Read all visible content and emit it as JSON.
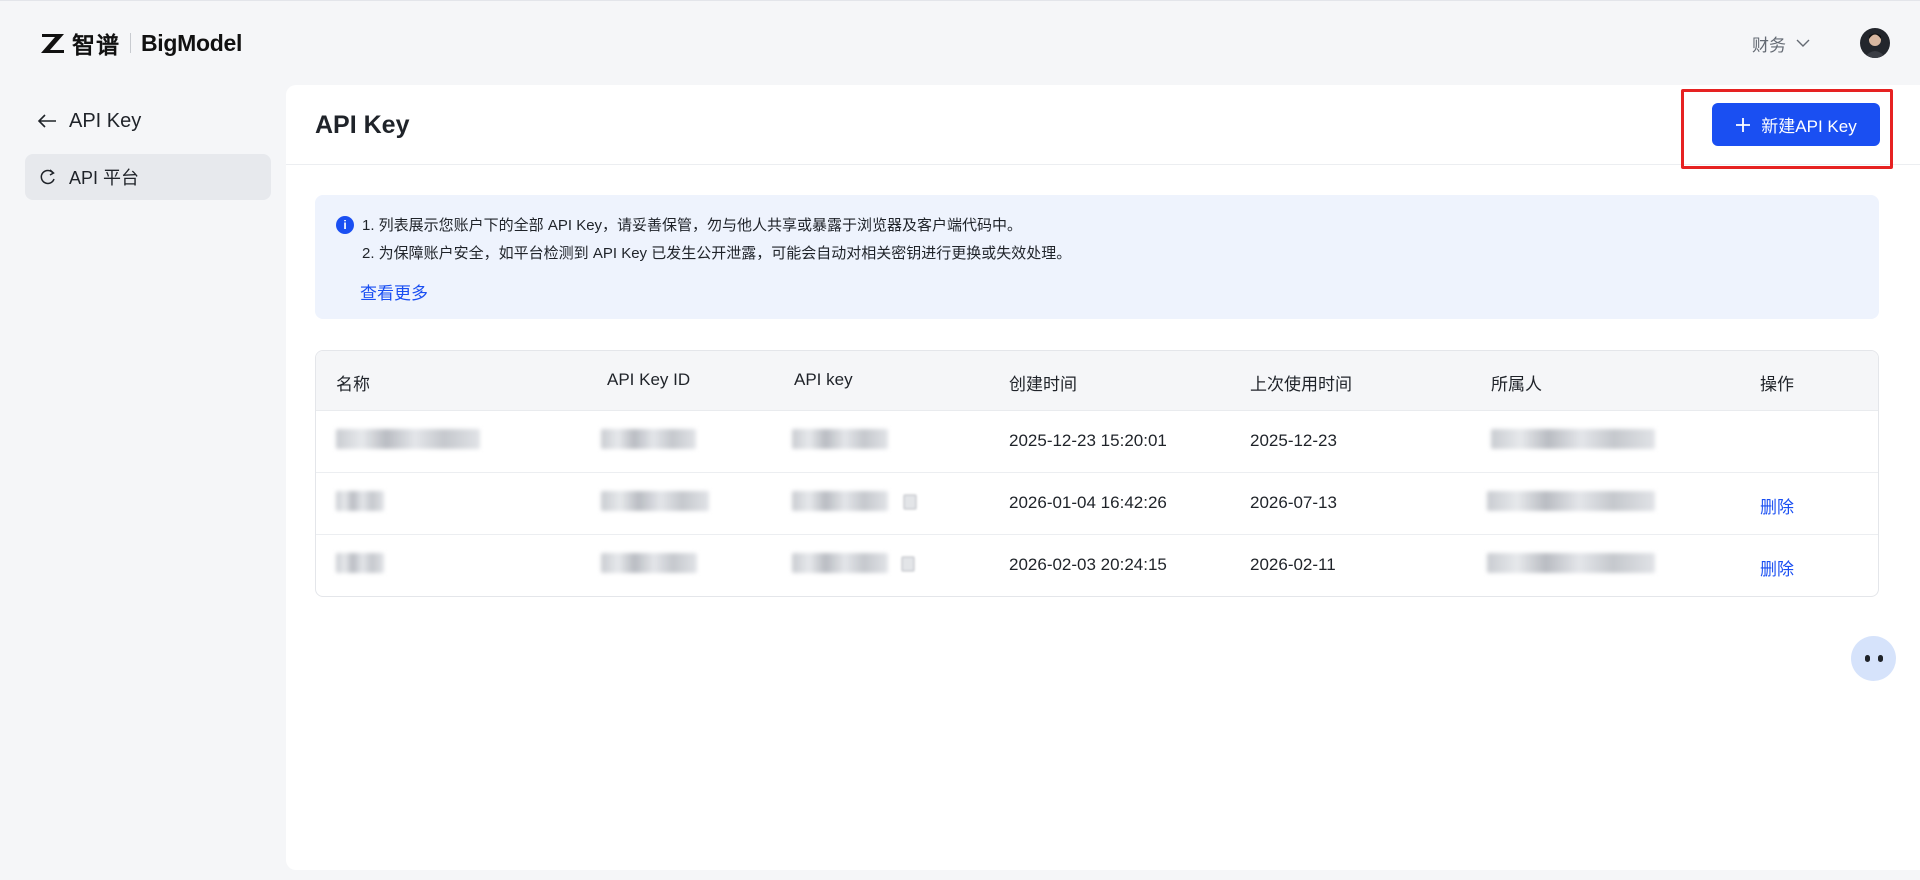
{
  "header": {
    "logo_cn": "智谱",
    "logo_en": "BigModel",
    "finance_label": "财务"
  },
  "sidebar": {
    "back_label": "API Key",
    "items": [
      {
        "label": "API 平台"
      }
    ]
  },
  "main": {
    "title": "API Key",
    "new_button_label": "新建API Key"
  },
  "notice": {
    "icon": "i",
    "line1": "1. 列表展示您账户下的全部 API Key，请妥善保管，勿与他人共享或暴露于浏览器及客户端代码中。",
    "line2": "2. 为保障账户安全，如平台检测到 API Key 已发生公开泄露，可能会自动对相关密钥进行更换或失效处理。",
    "link": "查看更多"
  },
  "table": {
    "headers": [
      "名称",
      "API Key ID",
      "API key",
      "创建时间",
      "上次使用时间",
      "所属人",
      "操作"
    ],
    "rows": [
      {
        "created": "2025-12-23 15:20:01",
        "last_used": "2025-12-23",
        "action": ""
      },
      {
        "created": "2026-01-04 16:42:26",
        "last_used": "2026-07-13",
        "action": "删除"
      },
      {
        "created": "2026-02-03 20:24:15",
        "last_used": "2026-02-11",
        "action": "删除"
      }
    ]
  },
  "colors": {
    "primary": "#1a4ff2",
    "highlight": "#e62222",
    "notice_bg": "#eef3fd",
    "page_bg": "#f5f6f8"
  },
  "icons": [
    "zhipu-logo-icon",
    "chevron-down-icon",
    "avatar",
    "arrow-left-icon",
    "api-platform-icon",
    "plus-icon",
    "info-icon",
    "copy-icon",
    "assistant-bot-icon"
  ]
}
